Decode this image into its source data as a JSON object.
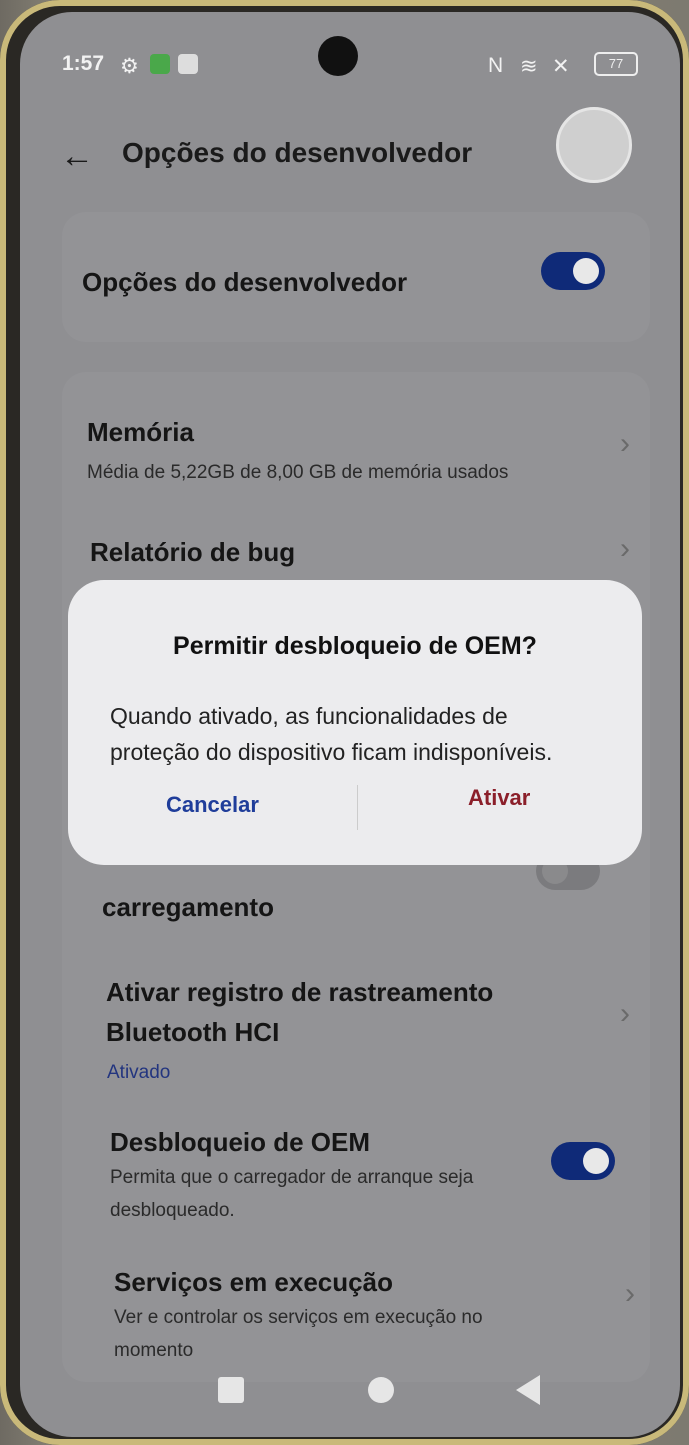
{
  "status": {
    "time": "1:57",
    "battery": "77"
  },
  "header": {
    "title": "Opções do desenvolvedor"
  },
  "dev_toggle": {
    "label": "Opções do desenvolvedor",
    "on": true
  },
  "rows": {
    "memory": {
      "title": "Memória",
      "subtitle": "Média de 5,22GB de 8,00 GB de memória usados"
    },
    "bug_report": {
      "title": "Relatório de bug"
    },
    "stay_awake": {
      "title_partial": "carregamento"
    },
    "bt_hci": {
      "title_line1": "Ativar registro de rastreamento",
      "title_line2": "Bluetooth HCI",
      "status": "Ativado"
    },
    "oem": {
      "title": "Desbloqueio de OEM",
      "subtitle_line1": "Permita que o carregador de arranque seja",
      "subtitle_line2": "desbloqueado.",
      "on": true
    },
    "running": {
      "title": "Serviços em execução",
      "subtitle_line1": "Ver e controlar os serviços em execução no",
      "subtitle_line2": "momento"
    }
  },
  "dialog": {
    "title": "Permitir desbloqueio de OEM?",
    "body_line1": "Quando ativado, as funcionalidades de",
    "body_line2": "proteção do dispositivo ficam indisponíveis.",
    "cancel": "Cancelar",
    "confirm": "Ativar"
  },
  "colors": {
    "accent": "#0f2a78",
    "confirm": "#8b1f2a",
    "cancel": "#1f3d9a"
  }
}
